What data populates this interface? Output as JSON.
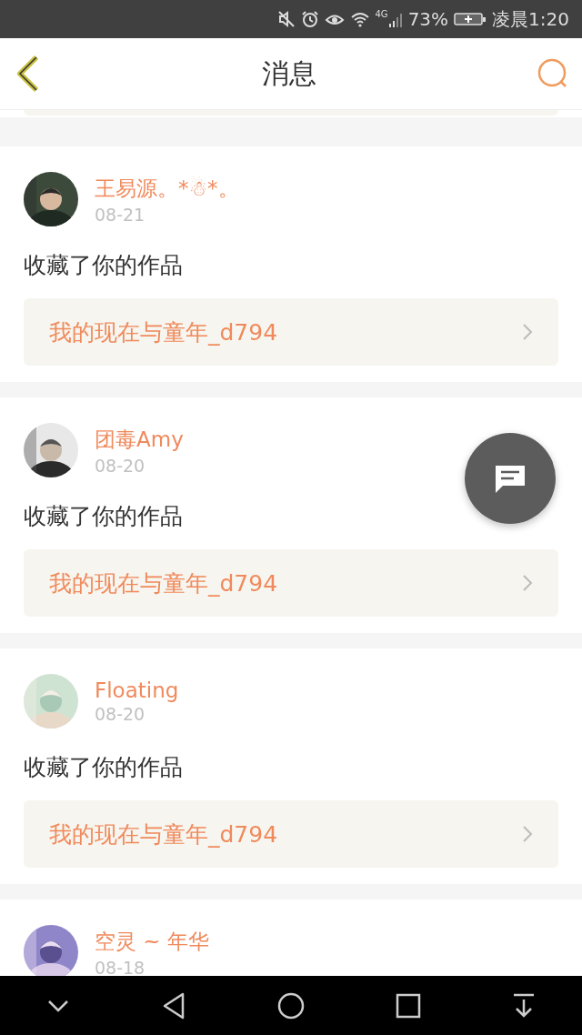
{
  "status_bar": {
    "network": "4G",
    "battery": "73%",
    "time": "凌晨1:20"
  },
  "header": {
    "title": "消息"
  },
  "messages": [
    {
      "user": "王易源。*☃*。",
      "date": "08-21",
      "action": "收藏了你的作品",
      "work": "我的现在与童年_d794"
    },
    {
      "user": "团毒Amy",
      "date": "08-20",
      "action": "收藏了你的作品",
      "work": "我的现在与童年_d794"
    },
    {
      "user": "Floating",
      "date": "08-20",
      "action": "收藏了你的作品",
      "work": "我的现在与童年_d794"
    },
    {
      "user": "空灵 ~ 年华",
      "date": "08-18"
    }
  ]
}
